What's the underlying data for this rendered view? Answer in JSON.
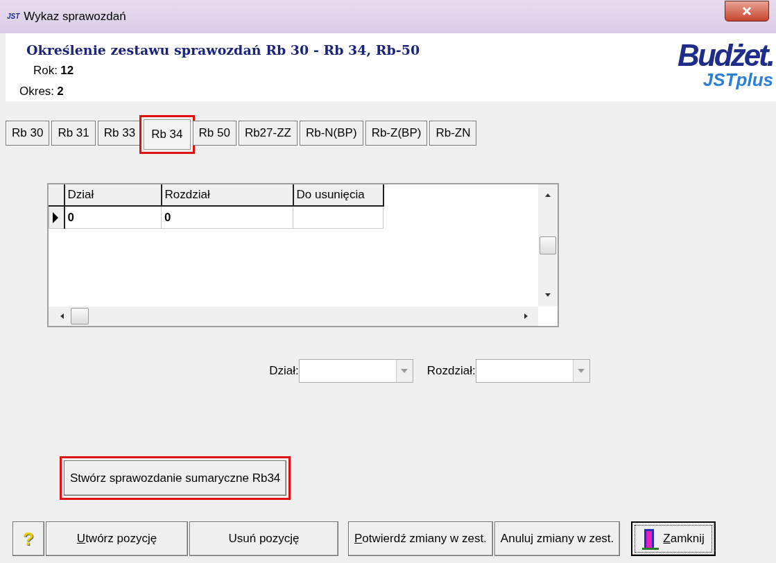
{
  "window": {
    "title": "Wykaz sprawozdań",
    "app_badge": "JST"
  },
  "header": {
    "heading": "Określenie zestawu sprawozdań Rb 30 - Rb 34, Rb-50",
    "fields": [
      {
        "label": "Rok:",
        "value": "12"
      },
      {
        "label": "Okres:",
        "value": "2"
      }
    ],
    "logo": {
      "main": "Budżet",
      "dot": ".",
      "sub_a": "JST",
      "sub_b": "plus"
    }
  },
  "tabs": [
    {
      "label": "Rb 30",
      "selected": false,
      "highlighted": false
    },
    {
      "label": "Rb 31",
      "selected": false,
      "highlighted": false
    },
    {
      "label": "Rb 33",
      "selected": false,
      "highlighted": false
    },
    {
      "label": "Rb 34",
      "selected": true,
      "highlighted": true
    },
    {
      "label": "Rb 50",
      "selected": false,
      "highlighted": false
    },
    {
      "label": "Rb27-ZZ",
      "selected": false,
      "highlighted": false
    },
    {
      "label": "Rb-N(BP)",
      "selected": false,
      "highlighted": false
    },
    {
      "label": "Rb-Z(BP)",
      "selected": false,
      "highlighted": false
    },
    {
      "label": "Rb-ZN",
      "selected": false,
      "highlighted": false
    }
  ],
  "grid": {
    "columns": [
      "Dział",
      "Rozdział",
      "Do usunięcia"
    ],
    "rows": [
      {
        "cells": [
          "0",
          "0",
          ""
        ],
        "current": true
      }
    ]
  },
  "filters": [
    {
      "label": "Dział:"
    },
    {
      "label": "Rozdział:"
    }
  ],
  "summary_button": {
    "label": "Stwórz sprawozdanie sumaryczne Rb34",
    "highlighted": true
  },
  "footer": {
    "help": "?",
    "buttons": [
      {
        "label": "Utwórz pozycję",
        "mnemonic_first": true,
        "kind": "plain"
      },
      {
        "label": "Usuń pozycję",
        "mnemonic_first": false,
        "kind": "plain"
      },
      {
        "label": "Potwierdź zmiany w zest.",
        "mnemonic_first": true,
        "kind": "plain"
      },
      {
        "label": "Anuluj zmiany w zest.",
        "mnemonic_first": false,
        "kind": "plain"
      },
      {
        "label": "Zamknij",
        "mnemonic_first": true,
        "kind": "close"
      }
    ]
  }
}
